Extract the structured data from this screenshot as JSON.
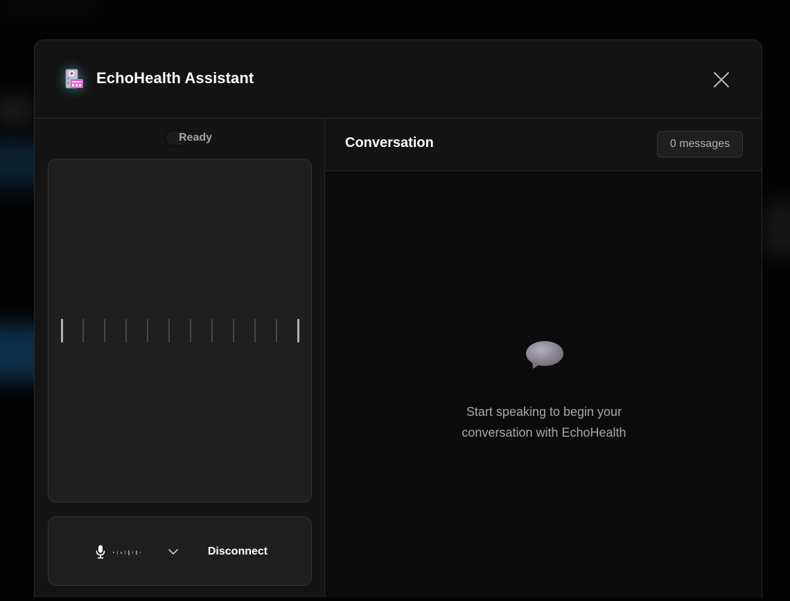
{
  "app": {
    "title": "EchoHealth Assistant",
    "logo_icon": "hospital-icon"
  },
  "status": {
    "label": "Ready"
  },
  "visualizer": {
    "bar_count": 12
  },
  "controls": {
    "mic_icon": "microphone-icon",
    "device_icon": "chevron-down-icon",
    "disconnect_label": "Disconnect"
  },
  "conversation": {
    "title": "Conversation",
    "message_count": "0 messages",
    "empty_icon": "speech-bubble-icon",
    "empty_text": "Start speaking to begin your\nconversation with EchoHealth"
  },
  "colors": {
    "background": "#030303",
    "panel": "#131313",
    "card": "#1f1f1f",
    "accent_glow": "#5ac8e6"
  }
}
